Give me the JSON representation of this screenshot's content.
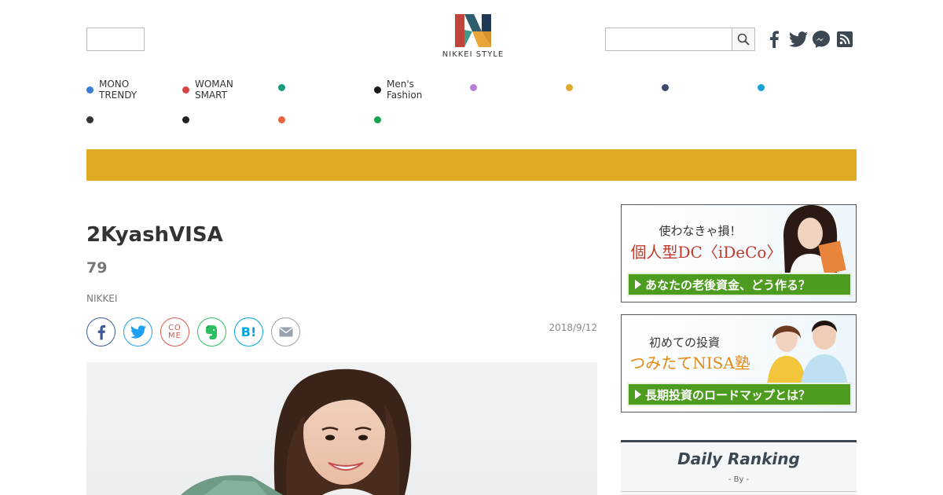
{
  "header": {
    "logo_text": "NIKKEI STYLE",
    "search": {
      "placeholder": "",
      "value": ""
    },
    "social": [
      "facebook-icon",
      "twitter-icon",
      "messenger-icon",
      "rss-icon"
    ]
  },
  "nav": {
    "items": [
      {
        "label_line1": "MONO",
        "label_line2": "TRENDY",
        "color": "#3a7bd5"
      },
      {
        "label_line1": "WOMAN",
        "label_line2": "SMART",
        "color": "#d64541"
      },
      {
        "label_line1": "",
        "label_line2": "",
        "color": "#1a9b7a"
      },
      {
        "label_line1": "Men's",
        "label_line2": "Fashion",
        "color": "#1a1a1a"
      },
      {
        "label_line1": "",
        "label_line2": "",
        "color": "#b67fd8"
      },
      {
        "label_line1": "",
        "label_line2": "",
        "color": "#e0a82e"
      },
      {
        "label_line1": "",
        "label_line2": "",
        "color": "#3b4a6b"
      },
      {
        "label_line1": "",
        "label_line2": "",
        "color": "#1aa1d8"
      },
      {
        "label_line1": "",
        "label_line2": "",
        "color": "#333333"
      },
      {
        "label_line1": "",
        "label_line2": "",
        "color": "#222222"
      },
      {
        "label_line1": "",
        "label_line2": "",
        "color": "#e8643c"
      },
      {
        "label_line1": "",
        "label_line2": "",
        "color": "#16a34a"
      }
    ]
  },
  "banner_color": "#e0a921",
  "article": {
    "title": "2KyashVISA",
    "subtitle": "79",
    "source": "NIKKEI",
    "date": "2018/9/12",
    "share": [
      "facebook-share",
      "twitter-share",
      "come-share",
      "evernote-share",
      "hatena-share",
      "mail-share"
    ],
    "come_label_top": "CO",
    "come_label_bottom": "ME",
    "hatena_label": "B!"
  },
  "ads": [
    {
      "line1": "使わなきゃ損！",
      "line2": "個人型DC〈iDeCo〉",
      "button": "あなたの老後資金、どう作る？"
    },
    {
      "line1": "初めての投資",
      "line2": "つみたてNISA塾",
      "button": "長期投資のロードマップとは？"
    }
  ],
  "ranking": {
    "title": "Daily Ranking",
    "subtitle": "- By -"
  }
}
